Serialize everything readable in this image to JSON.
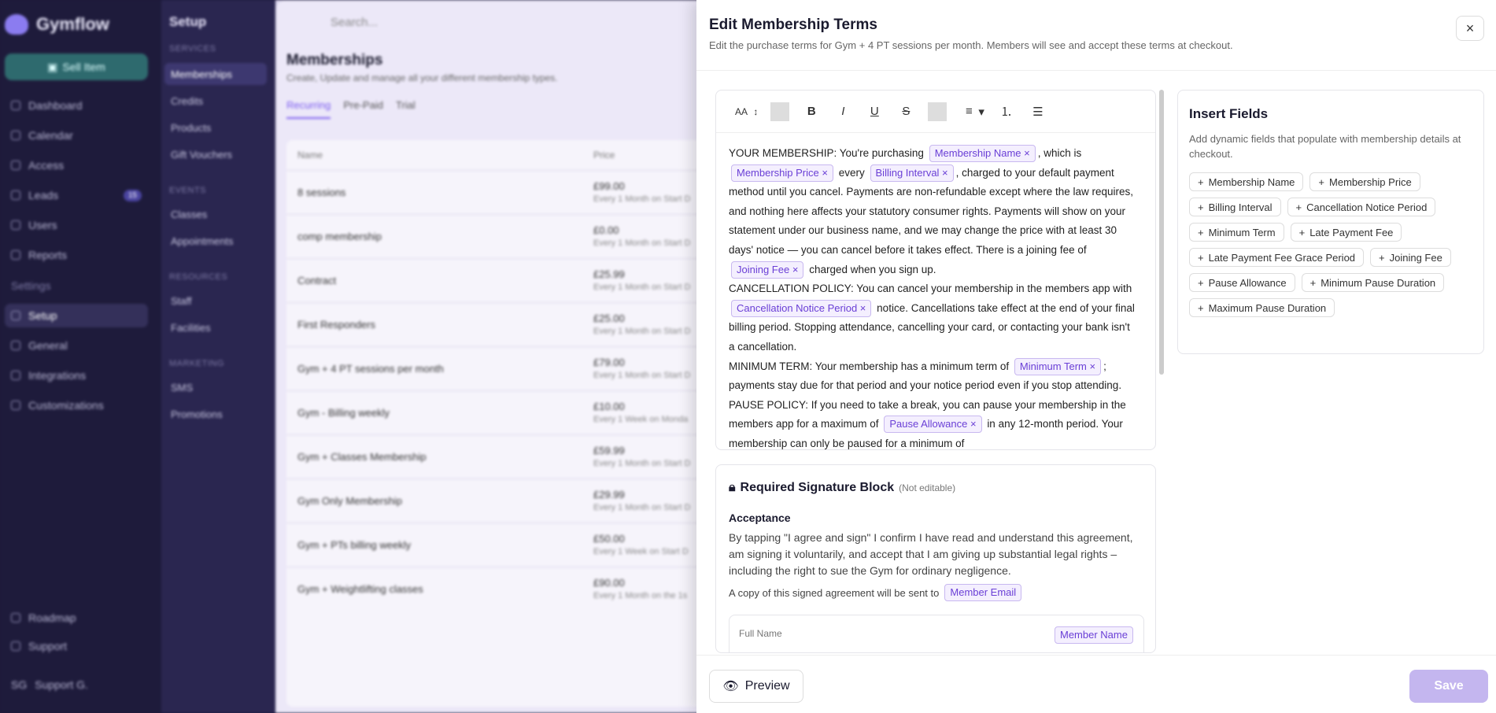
{
  "app": {
    "name": "Gymflow",
    "sell_label": "Sell Item"
  },
  "nav": [
    {
      "label": "Dashboard"
    },
    {
      "label": "Calendar"
    },
    {
      "label": "Access"
    },
    {
      "label": "Leads",
      "badge": "15"
    },
    {
      "label": "Users"
    },
    {
      "label": "Reports"
    },
    {
      "label": "Settings"
    },
    {
      "label": "Setup"
    },
    {
      "label": "General"
    },
    {
      "label": "Integrations"
    },
    {
      "label": "Customizations"
    }
  ],
  "nav_bottom": [
    {
      "label": "Roadmap"
    },
    {
      "label": "Support"
    }
  ],
  "user": {
    "initials": "SG",
    "name": "Support G."
  },
  "subnav": {
    "title": "Setup",
    "groups": [
      {
        "label": "SERVICES",
        "items": [
          "Memberships",
          "Credits",
          "Products",
          "Gift Vouchers"
        ]
      },
      {
        "label": "EVENTS",
        "items": [
          "Classes",
          "Appointments"
        ]
      },
      {
        "label": "RESOURCES",
        "items": [
          "Staff",
          "Facilities"
        ]
      },
      {
        "label": "MARKETING",
        "items": [
          "SMS",
          "Promotions"
        ]
      }
    ]
  },
  "main": {
    "search_placeholder": "Search...",
    "title": "Memberships",
    "subtitle": "Create, Update and manage all your different membership types.",
    "tabs": [
      "Recurring",
      "Pre-Paid",
      "Trial"
    ],
    "columns": [
      "Name",
      "Price"
    ],
    "rows": [
      {
        "name": "8 sessions",
        "price": "£99.00",
        "sub": "Every 1 Month on Start D"
      },
      {
        "name": "comp membership",
        "price": "£0.00",
        "sub": "Every 1 Month on Start D"
      },
      {
        "name": "Contract",
        "price": "£25.99",
        "sub": "Every 1 Month on Start D"
      },
      {
        "name": "First Responders",
        "price": "£25.00",
        "sub": "Every 1 Month on Start D"
      },
      {
        "name": "Gym + 4 PT sessions per month",
        "price": "£79.00",
        "sub": "Every 1 Month on Start D"
      },
      {
        "name": "Gym - Billing weekly",
        "price": "£10.00",
        "sub": "Every 1 Week on Monda"
      },
      {
        "name": "Gym + Classes Membership",
        "price": "£59.99",
        "sub": "Every 1 Month on Start D"
      },
      {
        "name": "Gym Only Membership",
        "price": "£29.99",
        "sub": "Every 1 Month on Start D"
      },
      {
        "name": "Gym + PTs billing weekly",
        "price": "£50.00",
        "sub": "Every 1 Week on Start D"
      },
      {
        "name": "Gym + Weightlifting classes",
        "price": "£90.00",
        "sub": "Every 1 Month on the 1s"
      }
    ]
  },
  "panel": {
    "title": "Edit Membership Terms",
    "subtitle": "Edit the purchase terms for Gym + 4 PT sessions per month. Members will see and accept these terms at checkout.",
    "close": "×",
    "toolbar": {
      "font": "AA",
      "bold": "B",
      "italic": "I",
      "underline": "U",
      "strike": "S"
    },
    "content": {
      "p1a": "YOUR MEMBERSHIP: You're purchasing",
      "chip_name": "Membership Name ×",
      "p1b": ", which is",
      "chip_price": "Membership Price ×",
      "p1c": "every",
      "chip_interval": "Billing Interval ×",
      "p1d": ", charged to your default payment method until you cancel. Payments are non-refundable except where the law requires, and nothing here affects your statutory consumer rights. Payments will show on your statement under our business name, and we may change the price with at least 30 days' notice — you can cancel before it takes effect. There is a joining fee of",
      "chip_joining": "Joining Fee ×",
      "p1e": "charged when you sign up.",
      "p2a": "CANCELLATION POLICY: You can cancel your membership in the members app with",
      "chip_cancel": "Cancellation Notice Period ×",
      "p2b": "notice. Cancellations take effect at the end of your final billing period. Stopping attendance, cancelling your card, or contacting your bank isn't a cancellation.",
      "p3a": "MINIMUM TERM: Your membership has a minimum term of",
      "chip_min": "Minimum Term ×",
      "p3b": "; payments stay due for that period and your notice period even if you stop attending.",
      "p4a": "PAUSE POLICY: If you need to take a break, you can pause your membership in the members app for a maximum of",
      "chip_pause": "Pause Allowance ×",
      "p4b": "in any 12-month period. Your membership can only be paused for a minimum of"
    },
    "signature": {
      "title": "Required Signature Block",
      "note": "(Not editable)",
      "acceptance": "Acceptance",
      "text": "By tapping \"I agree and sign\" I confirm I have read and understand this agreement, am signing it voluntarily, and accept that I am giving up substantial legal rights – including the right to sue the Gym for ordinary negligence.",
      "copy": "A copy of this signed agreement will be sent to",
      "copy_chip": "Member Email",
      "full_name": "Full Name",
      "name_chip": "Member Name"
    },
    "insert": {
      "title": "Insert Fields",
      "desc": "Add dynamic fields that populate with membership details at checkout.",
      "fields": [
        "Membership Name",
        "Membership Price",
        "Billing Interval",
        "Cancellation Notice Period",
        "Minimum Term",
        "Late Payment Fee",
        "Late Payment Fee Grace Period",
        "Joining Fee",
        "Pause Allowance",
        "Minimum Pause Duration",
        "Maximum Pause Duration"
      ]
    },
    "preview_label": "Preview",
    "save_label": "Save"
  }
}
